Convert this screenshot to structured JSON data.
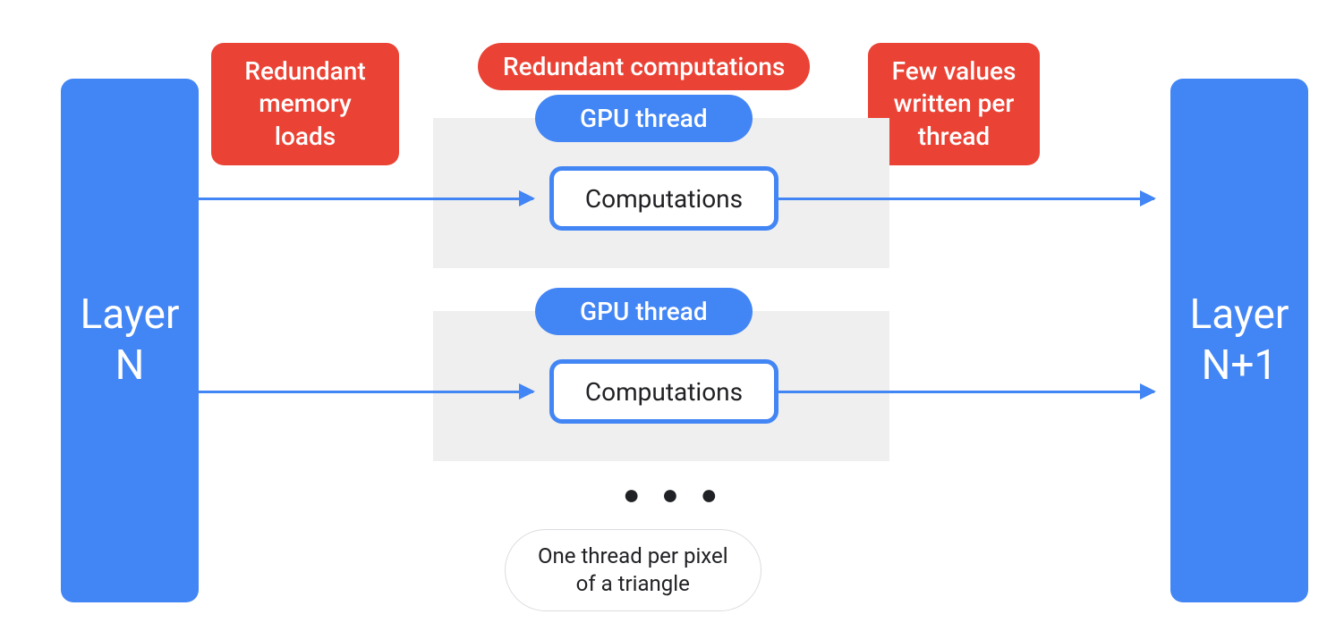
{
  "colors": {
    "blue": "#4285F4",
    "red": "#EA4335",
    "gray_bg": "#EFEFEF",
    "text": "#202124"
  },
  "layer_left": "Layer\nN",
  "layer_right": "Layer\nN+1",
  "badge_redundant_memory": "Redundant\nmemory\nloads",
  "badge_redundant_comp": "Redundant computations",
  "badge_few_values": "Few values\nwritten per\nthread",
  "gpu_thread_label": "GPU thread",
  "computations_label": "Computations",
  "ellipsis": "● ● ●",
  "footnote": "One thread per pixel\nof a triangle"
}
